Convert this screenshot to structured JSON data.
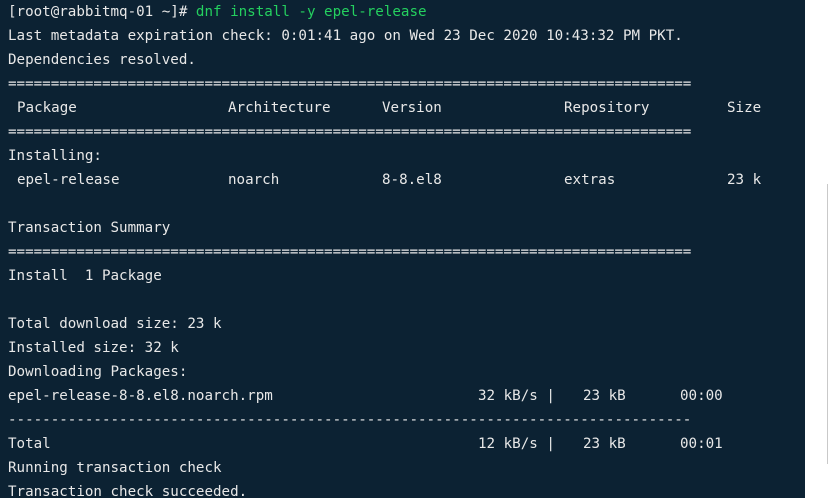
{
  "terminal": {
    "prompt": "[root@rabbitmq-01 ~]# ",
    "command": "dnf install -y epel-release",
    "metadata_line": "Last metadata expiration check: 0:01:41 ago on Wed 23 Dec 2020 10:43:32 PM PKT.",
    "deps_resolved": "Dependencies resolved.",
    "sep_double": "================================================================================",
    "sep_single": "--------------------------------------------------------------------------------",
    "table_header": {
      "package": "Package",
      "architecture": "Architecture",
      "version": "Version",
      "repository": "Repository",
      "size": "Size"
    },
    "installing_label": "Installing:",
    "package_row": {
      "name": "epel-release",
      "arch": "noarch",
      "version": "8-8.el8",
      "repo": "extras",
      "size": "23 k"
    },
    "transaction_summary": "Transaction Summary",
    "install_count": "Install  1 Package",
    "total_download": "Total download size: 23 k",
    "installed_size": "Installed size: 32 k",
    "downloading": "Downloading Packages:",
    "download_row": {
      "file": "epel-release-8-8.el8.noarch.rpm",
      "speed": "32 kB/s |",
      "size": "23 kB",
      "time": "00:00"
    },
    "total_row": {
      "label": "Total",
      "speed": "12 kB/s |",
      "size": "23 kB",
      "time": "00:01"
    },
    "running_check": "Running transaction check",
    "check_succeeded": "Transaction check succeeded."
  },
  "colors": {
    "background": "#0c2233",
    "text": "#e8e8e8",
    "command": "#24d05f"
  }
}
